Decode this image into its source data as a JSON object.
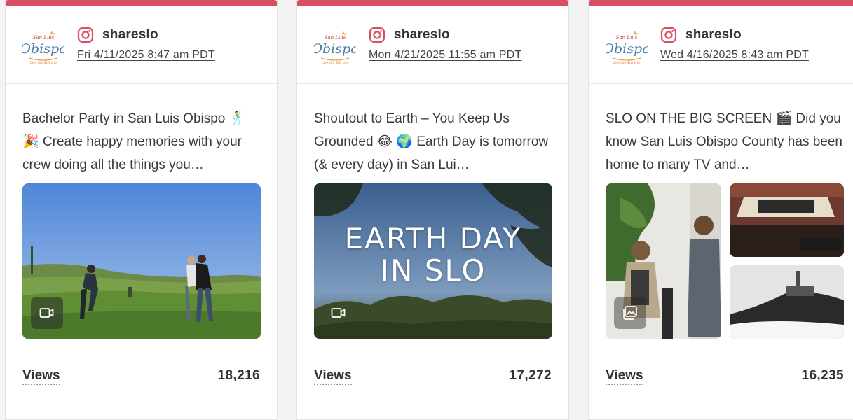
{
  "posts": [
    {
      "account": "shareslo",
      "date": "Fri 4/11/2025 8:47 am PDT",
      "caption": "Bachelor Party in San Luis Obispo 🕺 🎉 Create happy memories with your crew doing all the things you…",
      "media_type": "video",
      "views_label": "Views",
      "views": "18,216"
    },
    {
      "account": "shareslo",
      "date": "Mon 4/21/2025 11:55 am PDT",
      "caption": "Shoutout to Earth – You Keep Us Grounded 😂 🌍 Earth Day is tomorrow (& every day) in San Lui…",
      "media_type": "video",
      "media_text": "EARTH DAY IN SLO",
      "views_label": "Views",
      "views": "17,272"
    },
    {
      "account": "shareslo",
      "date": "Wed 4/16/2025 8:43 am PDT",
      "caption": "SLO ON THE BIG SCREEN 🎬 Did you know San Luis Obispo County has been home to many TV and…",
      "media_type": "gallery",
      "views_label": "Views",
      "views": "16,235"
    }
  ],
  "colors": {
    "accent": "#d94e63",
    "instagram": "#d94e63"
  },
  "icons": {
    "platform": "instagram-icon",
    "video": "video-camera-icon",
    "gallery": "image-gallery-icon"
  }
}
